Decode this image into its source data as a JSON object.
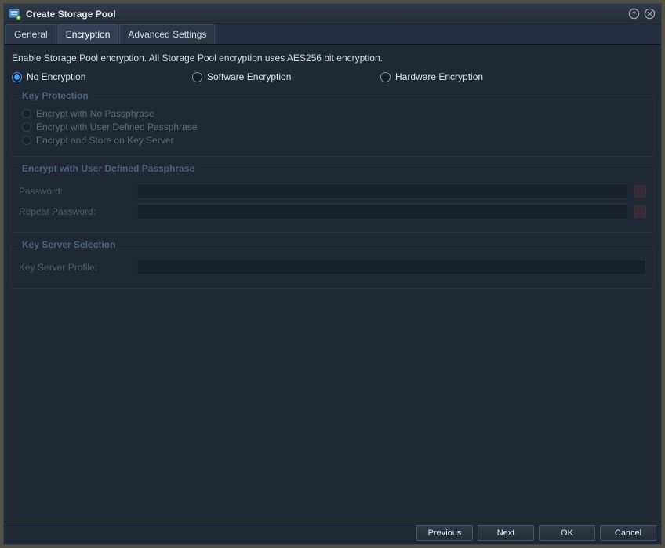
{
  "title": "Create Storage Pool",
  "tabs": [
    {
      "label": "General",
      "active": false
    },
    {
      "label": "Encryption",
      "active": true
    },
    {
      "label": "Advanced Settings",
      "active": false
    }
  ],
  "description": "Enable Storage Pool encryption. All Storage Pool encryption uses AES256 bit encryption.",
  "encryption_options": [
    {
      "label": "No Encryption",
      "selected": true
    },
    {
      "label": "Software Encryption",
      "selected": false
    },
    {
      "label": "Hardware Encryption",
      "selected": false
    }
  ],
  "key_protection": {
    "legend": "Key Protection",
    "options": [
      {
        "label": "Encrypt with No Passphrase"
      },
      {
        "label": "Encrypt with User Defined Passphrase"
      },
      {
        "label": "Encrypt and Store on Key Server"
      }
    ]
  },
  "passphrase_section": {
    "legend": "Encrypt with User Defined Passphrase",
    "password_label": "Password:",
    "repeat_password_label": "Repeat Password:"
  },
  "key_server_section": {
    "legend": "Key Server Selection",
    "profile_label": "Key Server Profile:"
  },
  "buttons": {
    "previous": "Previous",
    "next": "Next",
    "ok": "OK",
    "cancel": "Cancel"
  }
}
